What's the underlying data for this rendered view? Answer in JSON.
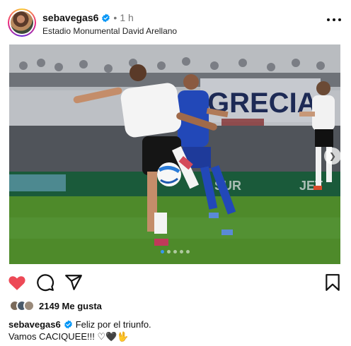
{
  "post": {
    "username": "sebavegas6",
    "separator": "•",
    "time": "1 h",
    "location": "Estadio Monumental David Arellano",
    "likes": "2149 Me gusta",
    "caption_line1": "Feliz por el triunfo.",
    "caption_line2": "Vamos CACIQUEE!!! ♡🖤🖖"
  },
  "photo": {
    "banner_text": "GRECIA",
    "ad_text_left": "SUR",
    "ad_text_right": "JET",
    "carousel_total": 5,
    "carousel_active": 0,
    "next_icon": "chevron-right-icon"
  },
  "icons": {
    "verified": "verified-badge-icon",
    "more": "more-horizontal-icon",
    "like": "heart-filled-icon",
    "comment": "comment-icon",
    "share": "send-icon",
    "save": "bookmark-icon"
  },
  "colors": {
    "like": "#ed4956",
    "verified": "#0095f6",
    "active_dot": "#3897f0"
  }
}
